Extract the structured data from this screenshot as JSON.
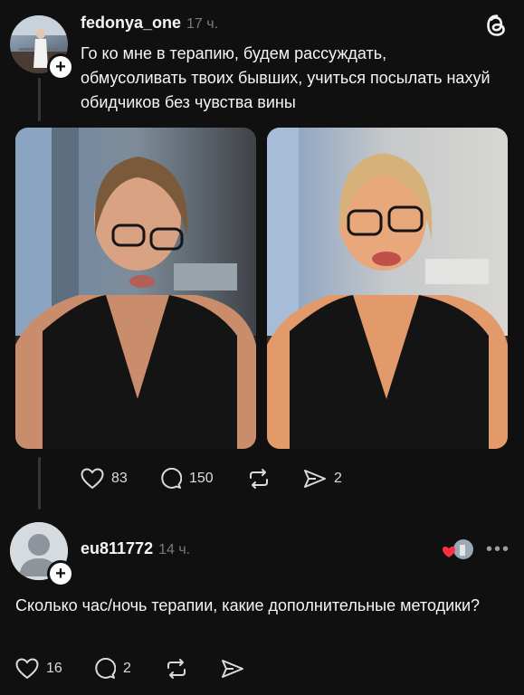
{
  "post": {
    "username": "fedonya_one",
    "time": "17 ч.",
    "text": "Го ко мне в терапию, будем рассуждать, обмусоливать твоих бывших, учиться посылать нахуй обидчиков без чувства вины",
    "likes": "83",
    "replies": "150",
    "shares": "2"
  },
  "reply": {
    "username": "eu811772",
    "time": "14 ч.",
    "text": "Сколько час/ночь терапии, какие дополнительные методики?",
    "likes": "16",
    "replies": "2"
  },
  "colors": {
    "background": "#101010",
    "text": "#f3f5f7",
    "muted": "#777b80",
    "like_red": "#ff3040"
  },
  "icons": [
    "threads-logo-icon",
    "heart-icon",
    "comment-icon",
    "repost-icon",
    "share-icon",
    "more-icon"
  ]
}
